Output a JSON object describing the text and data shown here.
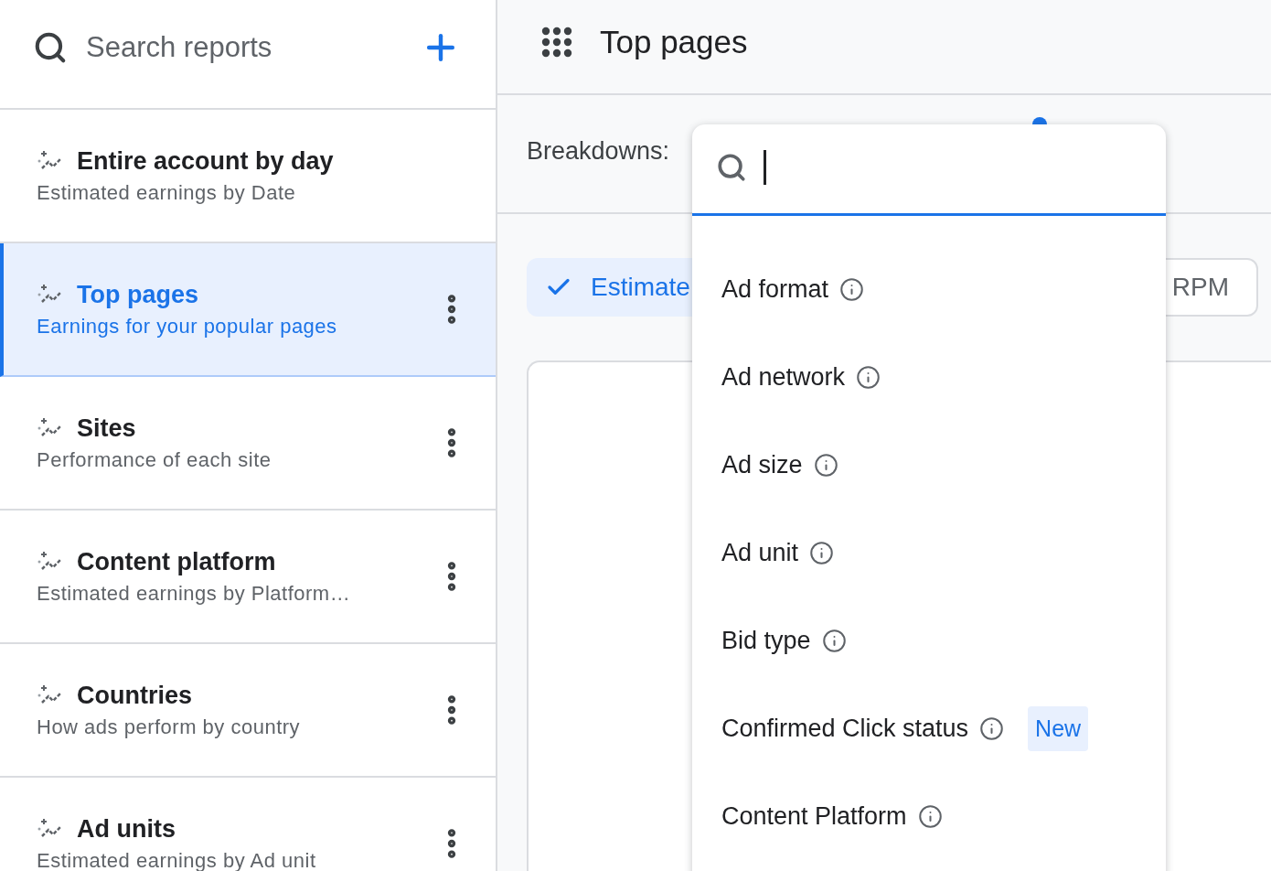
{
  "sidebar": {
    "search": {
      "placeholder": "Search reports"
    },
    "items": [
      {
        "title": "Entire account by day",
        "subtitle": "Estimated earnings by Date",
        "selected": false,
        "has_menu": false
      },
      {
        "title": "Top pages",
        "subtitle": "Earnings for your popular pages",
        "selected": true,
        "has_menu": true
      },
      {
        "title": "Sites",
        "subtitle": "Performance of each site",
        "selected": false,
        "has_menu": true
      },
      {
        "title": "Content platform",
        "subtitle": "Estimated earnings by Platform…",
        "selected": false,
        "has_menu": true
      },
      {
        "title": "Countries",
        "subtitle": "How ads perform by country",
        "selected": false,
        "has_menu": true
      },
      {
        "title": "Ad units",
        "subtitle": "Estimated earnings by Ad unit",
        "selected": false,
        "has_menu": true
      }
    ]
  },
  "header": {
    "title": "Top pages"
  },
  "breakdowns": {
    "label": "Breakdowns:"
  },
  "metrics": [
    {
      "label": "Estimate",
      "selected": true
    },
    {
      "label": "RPM",
      "selected": false
    }
  ],
  "dropdown": {
    "options": [
      {
        "label": "Ad format"
      },
      {
        "label": "Ad network"
      },
      {
        "label": "Ad size"
      },
      {
        "label": "Ad unit"
      },
      {
        "label": "Bid type"
      },
      {
        "label": "Confirmed Click status",
        "badge": "New"
      },
      {
        "label": "Content Platform"
      }
    ]
  }
}
